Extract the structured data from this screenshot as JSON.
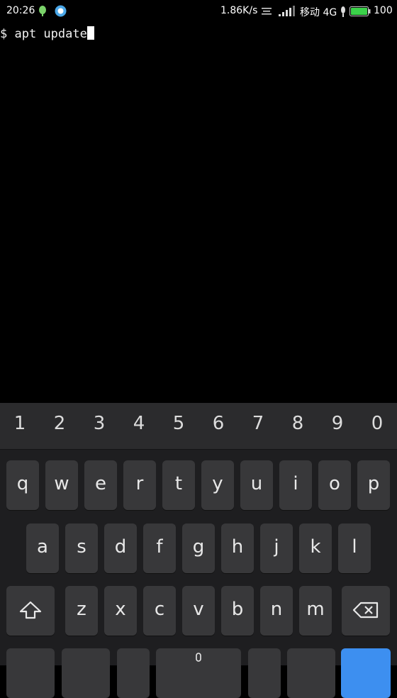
{
  "status_bar": {
    "time": "20:26",
    "network_speed": "1.86K/s",
    "carrier": "移动 4G",
    "battery": "100",
    "icons": [
      "leaf-notification-icon",
      "browser-notification-icon",
      "menu-lines-icon",
      "signal-icon",
      "mic-icon",
      "battery-icon"
    ]
  },
  "terminal": {
    "prompt": "$ apt update"
  },
  "keyboard": {
    "number_row": [
      "1",
      "2",
      "3",
      "4",
      "5",
      "6",
      "7",
      "8",
      "9",
      "0"
    ],
    "row1": [
      "q",
      "w",
      "e",
      "r",
      "t",
      "y",
      "u",
      "i",
      "o",
      "p"
    ],
    "row2": [
      "a",
      "s",
      "d",
      "f",
      "g",
      "h",
      "j",
      "k",
      "l"
    ],
    "row3": [
      "z",
      "x",
      "c",
      "v",
      "b",
      "n",
      "m"
    ],
    "accent_color": "#3d8ff0"
  }
}
